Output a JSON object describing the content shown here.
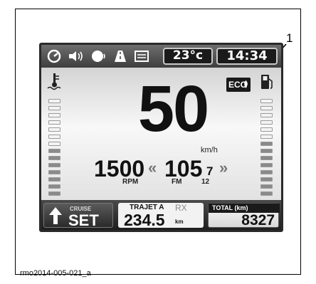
{
  "callout": {
    "number": "1"
  },
  "caption": "rmo2014-005-021_a",
  "topbar": {
    "icons": [
      "gauge-icon",
      "speaker-icon",
      "voice-icon",
      "road-icon",
      "menu-icon"
    ],
    "temperature": "23°c",
    "clock": "14:34"
  },
  "main": {
    "speed": "50",
    "speed_unit": "km/h",
    "eco_label": "ECO",
    "rpm_value": "1500",
    "rpm_label": "RPM",
    "radio_value": "105",
    "radio_decimal": "7",
    "radio_band": "FM",
    "radio_preset": "12",
    "coolant_level": 0.5,
    "fuel_level": 0.6
  },
  "bottombar": {
    "cruise_label": "CRUISE",
    "cruise_state": "SET",
    "trip_label": "TRAJET A",
    "trip_rx": "RX",
    "trip_value": "234.5",
    "trip_unit": "km",
    "total_label": "TOTAL (km)",
    "total_value": "8327"
  }
}
